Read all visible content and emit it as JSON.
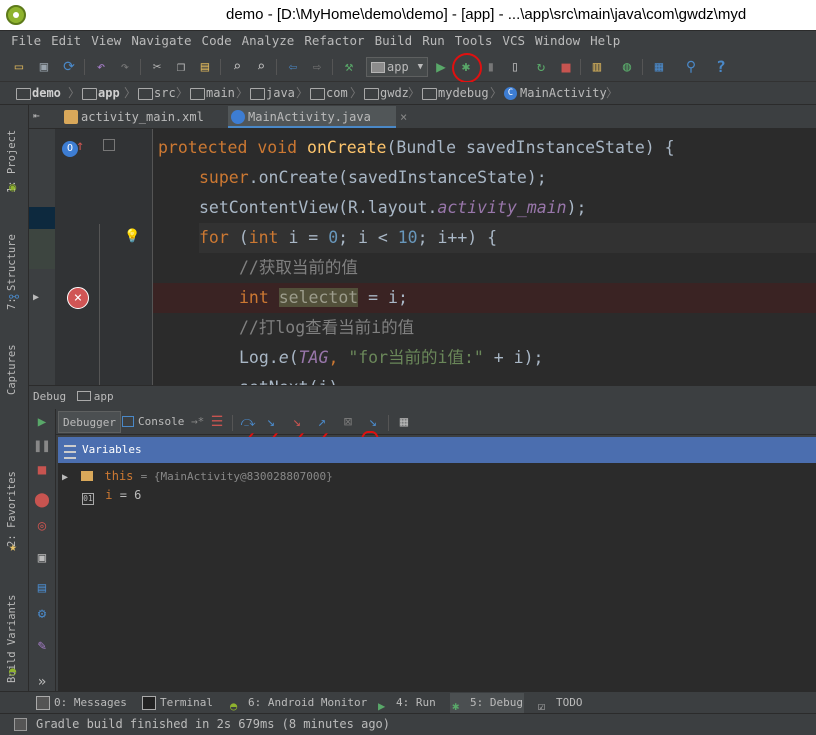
{
  "window": {
    "title": "demo - [D:\\MyHome\\demo\\demo] - [app] - ...\\app\\src\\main\\java\\com\\gwdz\\myd"
  },
  "menu": [
    "File",
    "Edit",
    "View",
    "Navigate",
    "Code",
    "Analyze",
    "Refactor",
    "Build",
    "Run",
    "Tools",
    "VCS",
    "Window",
    "Help"
  ],
  "toolbar": {
    "run_config": "app"
  },
  "breadcrumbs": [
    "demo",
    "app",
    "src",
    "main",
    "java",
    "com",
    "gwdz",
    "mydebug",
    "MainActivity"
  ],
  "side_tabs": {
    "project": "1: Project",
    "structure": "7: Structure",
    "captures": "Captures",
    "favorites": "2: Favorites",
    "build_variants": "Build Variants"
  },
  "editor_tabs": [
    "activity_main.xml",
    "MainActivity.java"
  ],
  "code": {
    "l1_kw": "protected void ",
    "l1_fn": "onCreate",
    "l1_rest": "(Bundle savedInstanceState) {",
    "l2_kw": "super",
    "l2_rest": ".onCreate(savedInstanceState);",
    "l3_a": "setContentView(R.layout.",
    "l3_b": "activity_main",
    "l3_c": ");",
    "l4_kw": "for ",
    "l4_a": "(",
    "l4_kw2": "int ",
    "l4_b": "i = ",
    "l4_n0": "0",
    "l4_c": "; i < ",
    "l4_n10": "10",
    "l4_d": "; i++) {",
    "l5": "//获取当前的值",
    "l6_kw": "int ",
    "l6_var": "selectot",
    "l6_rest": " = i;",
    "l7": "//打log查看当前i的值",
    "l8_a": "Log.",
    "l8_b": "e",
    "l8_c": "(",
    "l8_d": "TAG",
    "l8_e": ", ",
    "l8_str": "\"for当前的i值:\"",
    "l8_f": " + i);",
    "l9": "setNext(i)"
  },
  "debug": {
    "title": "Debug",
    "config": "app",
    "tabs": {
      "debugger": "Debugger",
      "console": "Console"
    },
    "variables_label": "Variables",
    "vars": [
      {
        "name": "this",
        "value": "= {MainActivity@830028807000}"
      },
      {
        "name": "i",
        "value": "= 6"
      }
    ]
  },
  "bottom_tabs": [
    "0: Messages",
    "Terminal",
    "6: Android Monitor",
    "4: Run",
    "5: Debug",
    "TODO"
  ],
  "status": "Gradle build finished in 2s 679ms (8 minutes ago)",
  "colors": {
    "accent": "#4a88c7",
    "selection": "#4b6eaf",
    "annotation": "#e01010",
    "run_green": "#59a869",
    "stop_red": "#c75450"
  }
}
